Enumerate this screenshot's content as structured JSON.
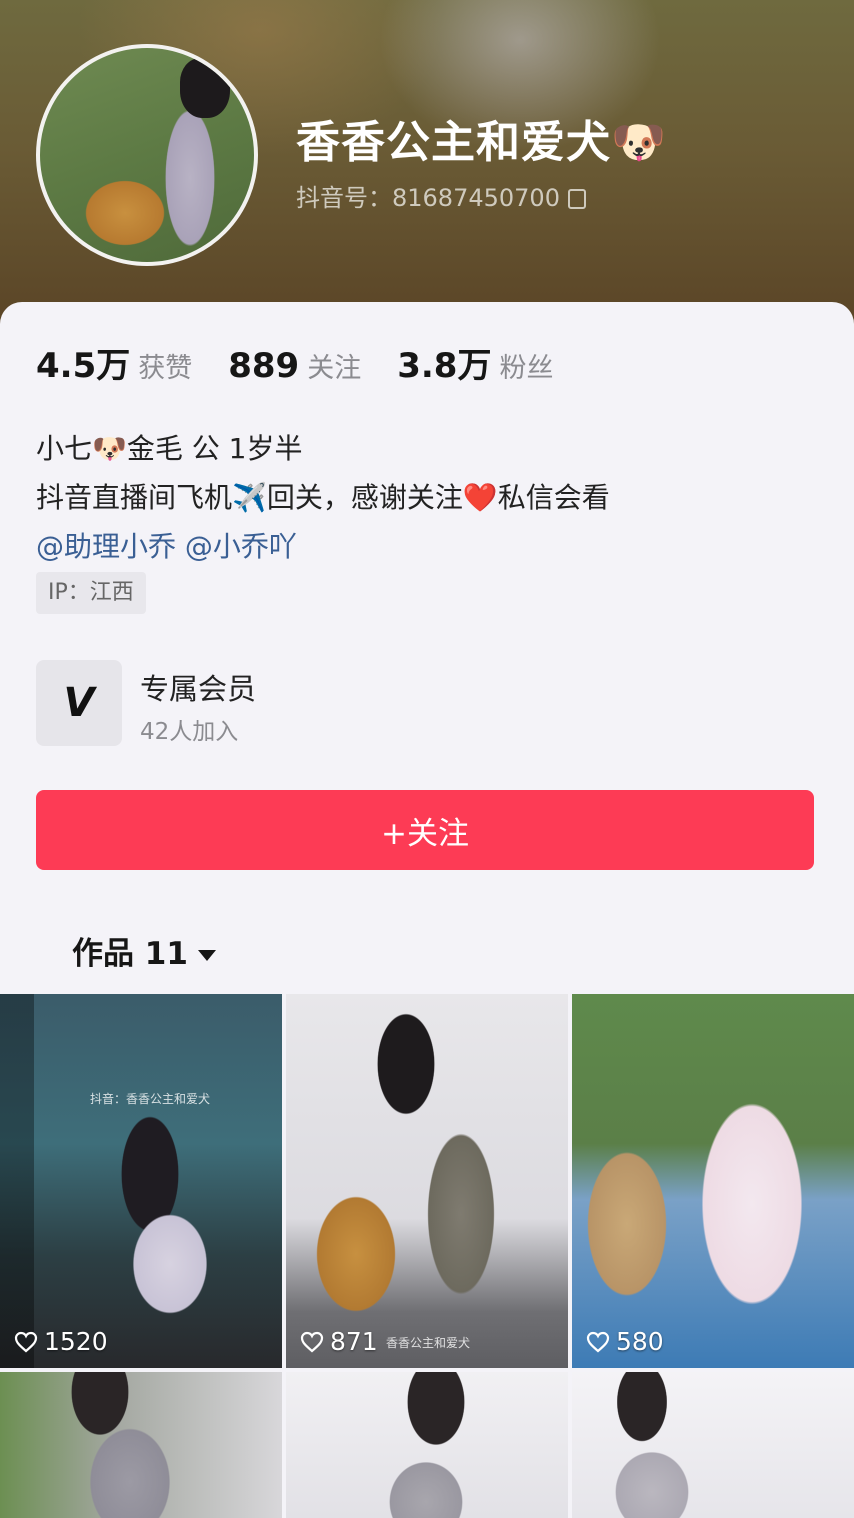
{
  "profile": {
    "name": "香香公主和爱犬🐶",
    "uid_label": "抖音号：81687450700"
  },
  "stats": [
    {
      "value": "4.5万",
      "label": "获赞"
    },
    {
      "value": "889",
      "label": "关注"
    },
    {
      "value": "3.8万",
      "label": "粉丝"
    }
  ],
  "bio": {
    "line1": "小七🐶金毛 公 1岁半",
    "line2": "抖音直播间飞机✈️回关，感谢关注❤️私信会看",
    "mention1": "@助理小乔",
    "mention2": "@小乔吖"
  },
  "ip_tag": "IP：江西",
  "membership": {
    "title": "专属会员",
    "subtitle": "42人加入",
    "icon_glyph": "V"
  },
  "follow_button": "+关注",
  "works_tab": "作品 11",
  "videos": [
    {
      "likes": "1520",
      "watermark": "抖音：香香公主和爱犬"
    },
    {
      "likes": "871",
      "watermark": "香香公主和爱犬"
    },
    {
      "likes": "580",
      "watermark": ""
    },
    {
      "likes": "",
      "watermark": ""
    },
    {
      "likes": "",
      "watermark": ""
    },
    {
      "likes": "",
      "watermark": ""
    }
  ],
  "colors": {
    "accent_red": "#fd3b55",
    "mention_blue": "#3a5f94"
  }
}
